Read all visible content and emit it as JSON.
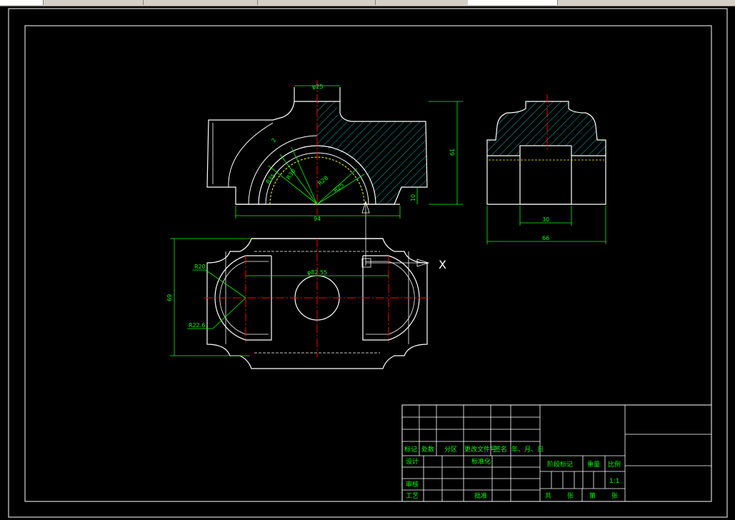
{
  "dims": {
    "top_width": "φ25",
    "overall_height": "61",
    "base_width": "94",
    "base_height": "10",
    "r_small": "2",
    "r_a": "R35",
    "r_b": "R30",
    "r_c": "R28",
    "r_d": "R25",
    "side_inner": "30",
    "side_outer": "66",
    "plan_height": "69",
    "plan_r20": "R20",
    "plan_r226": "R22.6",
    "plan_center": "φ82.55"
  },
  "view_marker": "X",
  "title_block": {
    "rev_headers": [
      "标记",
      "处数",
      "分区",
      "更改文件号",
      "签名",
      "年、月、日"
    ],
    "left_rows": [
      "设计",
      "审核",
      "工艺"
    ],
    "standardize": "标准化",
    "approve": "批准",
    "stage_mark": "阶段标记",
    "weight": "重量",
    "scale": "比例",
    "scale_value": "1:1",
    "sheet": [
      "共",
      "张",
      "第",
      "张"
    ]
  },
  "colors": {
    "outline": "#ffffff",
    "dimension": "#00ff00",
    "center": "#ff0000",
    "hatch": "#00c8c8"
  }
}
